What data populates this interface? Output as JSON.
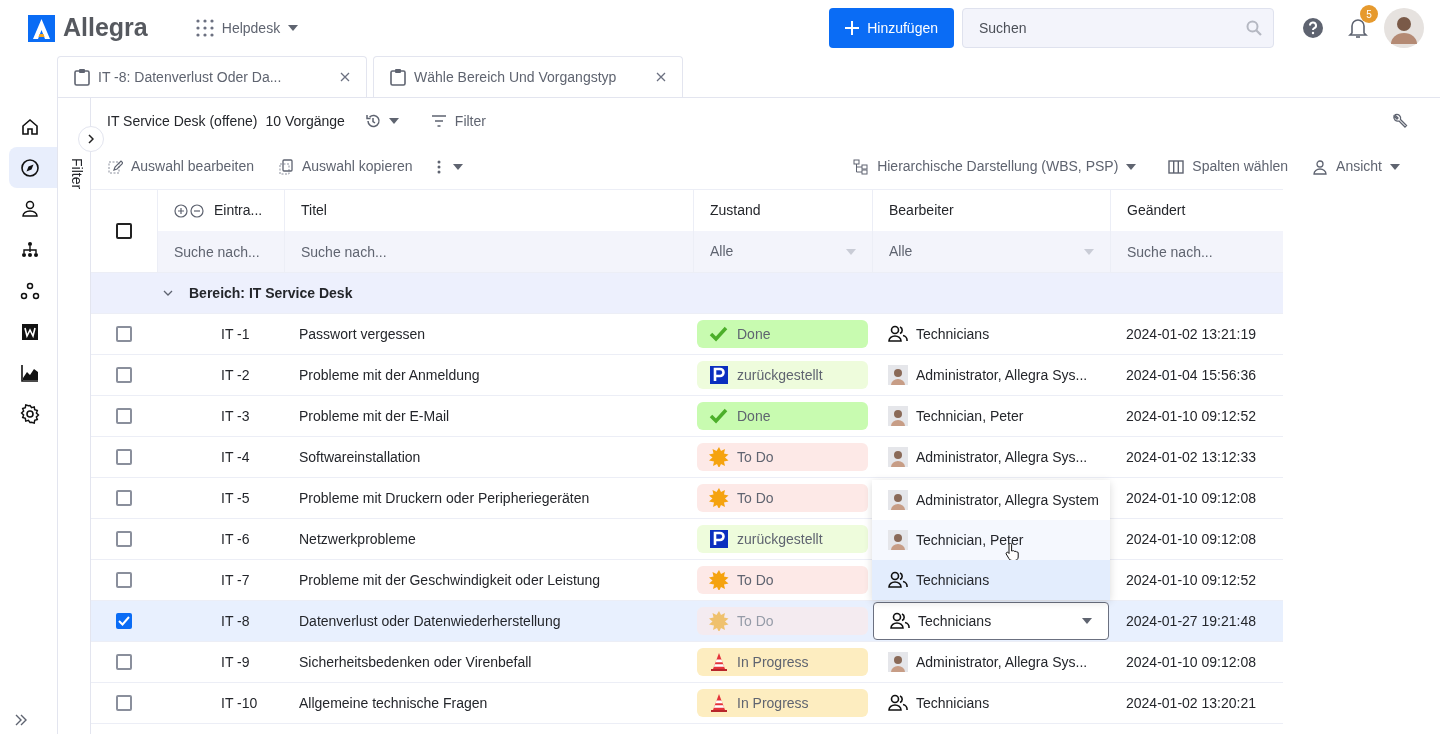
{
  "app": {
    "logo_text": "Allegra",
    "workspace": "Helpdesk"
  },
  "header": {
    "add_button": "Hinzufügen",
    "search_placeholder": "Suchen",
    "notifications": "5"
  },
  "sidebar": {
    "items": [
      {
        "kind": "home",
        "selected": false
      },
      {
        "kind": "compass",
        "selected": true
      },
      {
        "kind": "person",
        "selected": false
      },
      {
        "kind": "hierarchy",
        "selected": false
      },
      {
        "kind": "nodes",
        "selected": false
      },
      {
        "kind": "wiki",
        "selected": false
      },
      {
        "kind": "chart",
        "selected": false
      },
      {
        "kind": "gear",
        "selected": false
      }
    ]
  },
  "tabs": [
    {
      "label": "IT -8: Datenverlust Oder Da..."
    },
    {
      "label": "Wähle Bereich Und Vorgangstyp"
    }
  ],
  "filter_panel": {
    "label": "Filter"
  },
  "toolbar": {
    "title": "IT Service Desk (offene)",
    "count": "10 Vorgänge",
    "filter": "Filter",
    "edit_selection": "Auswahl bearbeiten",
    "copy_selection": "Auswahl kopieren",
    "hierarchy": "Hierarchische Darstellung (WBS, PSP)",
    "columns": "Spalten wählen",
    "view": "Ansicht"
  },
  "table": {
    "all_checked": false,
    "columns": [
      {
        "label": "Eintra...",
        "filter": {
          "kind": "search",
          "placeholder": "Suche nach..."
        }
      },
      {
        "label": "Titel",
        "filter": {
          "kind": "search",
          "placeholder": "Suche nach..."
        }
      },
      {
        "label": "Zustand",
        "filter": {
          "kind": "select",
          "value": "Alle"
        }
      },
      {
        "label": "Bearbeiter",
        "filter": {
          "kind": "select",
          "value": "Alle"
        }
      },
      {
        "label": "Geändert",
        "filter": {
          "kind": "search",
          "placeholder": "Suche nach..."
        }
      }
    ],
    "group": "Bereich: IT Service Desk",
    "rows": [
      {
        "selected": false,
        "id": "IT -1",
        "title": "Passwort vergessen",
        "status": {
          "kind": "done",
          "label": "Done"
        },
        "assignee": {
          "kind": "group",
          "name": "Technicians"
        },
        "changed": "2024-01-02 13:21:19"
      },
      {
        "selected": false,
        "id": "IT -2",
        "title": "Probleme mit der Anmeldung",
        "status": {
          "kind": "parked",
          "label": "zurückgestellt"
        },
        "assignee": {
          "kind": "person",
          "name": "Administrator, Allegra Sys..."
        },
        "changed": "2024-01-04 15:56:36"
      },
      {
        "selected": false,
        "id": "IT -3",
        "title": "Probleme mit der E-Mail",
        "status": {
          "kind": "done",
          "label": "Done"
        },
        "assignee": {
          "kind": "person",
          "name": "Technician, Peter"
        },
        "changed": "2024-01-10 09:12:52"
      },
      {
        "selected": false,
        "id": "IT -4",
        "title": "Softwareinstallation",
        "status": {
          "kind": "todo",
          "label": "To Do"
        },
        "assignee": {
          "kind": "person",
          "name": "Administrator, Allegra Sys..."
        },
        "changed": "2024-01-02 13:12:33"
      },
      {
        "selected": false,
        "id": "IT -5",
        "title": "Probleme mit Druckern oder Peripheriegeräten",
        "status": {
          "kind": "todo",
          "label": "To Do"
        },
        "changed": "2024-01-10 09:12:08"
      },
      {
        "selected": false,
        "id": "IT -6",
        "title": "Netzwerkprobleme",
        "status": {
          "kind": "parked",
          "label": "zurückgestellt"
        },
        "changed": "2024-01-10 09:12:08"
      },
      {
        "selected": false,
        "id": "IT -7",
        "title": "Probleme mit der Geschwindigkeit oder Leistung",
        "status": {
          "kind": "todo",
          "label": "To Do"
        },
        "changed": "2024-01-10 09:12:52"
      },
      {
        "selected": true,
        "id": "IT -8",
        "title": "Datenverlust oder Datenwiederherstellung",
        "status": {
          "kind": "todo",
          "label": "To Do"
        },
        "assignee": {
          "kind": "group",
          "name": "Technicians",
          "editing": true
        },
        "changed": "2024-01-27 19:21:48"
      },
      {
        "selected": false,
        "id": "IT -9",
        "title": "Sicherheitsbedenken oder Virenbefall",
        "status": {
          "kind": "inprogress",
          "label": "In Progress"
        },
        "assignee": {
          "kind": "person",
          "name": "Administrator, Allegra Sys..."
        },
        "changed": "2024-01-10 09:12:08"
      },
      {
        "selected": false,
        "id": "IT -10",
        "title": "Allgemeine technische Fragen",
        "status": {
          "kind": "inprogress",
          "label": "In Progress"
        },
        "assignee": {
          "kind": "group",
          "name": "Technicians"
        },
        "changed": "2024-01-02 13:20:21"
      }
    ]
  },
  "assignee_dropdown": {
    "options": [
      {
        "kind": "person",
        "name": "Administrator, Allegra System",
        "hovered": false,
        "selected": false
      },
      {
        "kind": "person",
        "name": "Technician, Peter",
        "hovered": true,
        "selected": false
      },
      {
        "kind": "group",
        "name": "Technicians",
        "hovered": false,
        "selected": true
      }
    ]
  }
}
